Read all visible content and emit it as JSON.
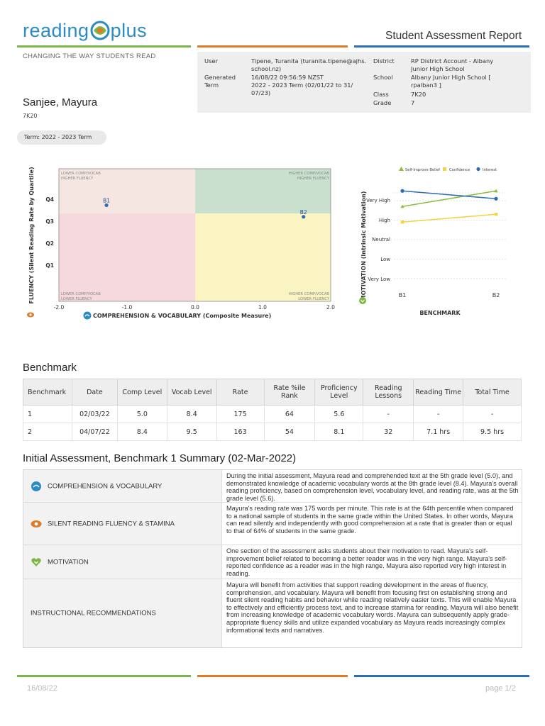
{
  "header": {
    "logo_left": "reading",
    "logo_right": "plus",
    "tagline": "CHANGING THE WAY STUDENTS READ",
    "report_title": "Student Assessment Report"
  },
  "meta": {
    "user_label": "User",
    "user_value": [
      "Tipene, Turanita (turanita.tipene@ajhs.",
      "school.nz)"
    ],
    "generated_label": "Generated",
    "generated_value": "16/08/22 09:56:59 NZST",
    "term_label": "Term",
    "term_value": [
      "2022 - 2023 Term  (02/01/22 to 31/",
      "07/23)"
    ],
    "district_label": "District",
    "district_value": [
      "RP District Account - Albany",
      "Junior High School"
    ],
    "school_label": "School",
    "school_value": [
      "Albany Junior High School [",
      "rpalban3 ]"
    ],
    "class_label": "Class",
    "class_value": "7K20",
    "grade_label": "Grade",
    "grade_value": "7"
  },
  "student": {
    "name": "Sanjee, Mayura",
    "class": "7K20",
    "term_pill": "Term: 2022 - 2023 Term"
  },
  "quadrant_chart": {
    "ylabel": "FLUENCY (Silent Reading Rate by Quartile)",
    "xlabel": "COMPREHENSION & VOCABULARY (Composite Measure)",
    "x_ticks": [
      "-2.0",
      "-1.0",
      "0.0",
      "1.0",
      "2.0"
    ],
    "y_ticks": [
      "Q4",
      "Q3",
      "Q2",
      "Q1"
    ],
    "q_tl": [
      "LOWER COMP/VOCAB",
      "HIGHER FLUENCY"
    ],
    "q_tr": [
      "HIGHER COMP/VOCAB",
      "HIGHER FLUENCY"
    ],
    "q_bl": [
      "LOWER COMP/VOCAB",
      "LOWER FLUENCY"
    ],
    "q_br": [
      "HIGHER COMP/VOCAB",
      "LOWER FLUENCY"
    ],
    "colors": {
      "tl": "#f5e6e2",
      "tr": "#c8e0cd",
      "bl": "#f6d9dc",
      "br": "#f9f4c2",
      "point": "#2e6db4"
    }
  },
  "motivation_chart": {
    "ylabel": "MOTIVATION (Intrinsic Motivation)",
    "xlabel": "BENCHMARK",
    "legend": [
      "Self-Improve Belief",
      "Confidence",
      "Interest"
    ],
    "y_ticks": [
      "Very High",
      "High",
      "Neutral",
      "Low",
      "Very Low"
    ],
    "x_ticks": [
      "B1",
      "B2"
    ],
    "colors": {
      "self_improve": "#8cbd3c",
      "confidence": "#f5d440",
      "interest": "#2e6db4"
    }
  },
  "chart_data": [
    {
      "type": "scatter",
      "xlabel": "COMPREHENSION & VOCABULARY (Composite Measure)",
      "ylabel": "FLUENCY (Silent Reading Rate by Quartile)",
      "xlim": [
        -2.0,
        2.0
      ],
      "ylim": [
        0,
        4
      ],
      "points": [
        {
          "label": "B1",
          "x": -1.3,
          "y": 2.9
        },
        {
          "label": "B2",
          "x": 1.6,
          "y": 2.55
        }
      ]
    },
    {
      "type": "line",
      "categories": [
        "B1",
        "B2"
      ],
      "ylabel": "MOTIVATION (Intrinsic Motivation)",
      "xlabel": "BENCHMARK",
      "y_scale": [
        "Very Low",
        "Low",
        "Neutral",
        "High",
        "Very High"
      ],
      "ylim": [
        1,
        5.4
      ],
      "series": [
        {
          "name": "Self-Improve Belief",
          "values": [
            4.7,
            5.5
          ]
        },
        {
          "name": "Confidence",
          "values": [
            3.9,
            4.3
          ]
        },
        {
          "name": "Interest",
          "values": [
            5.5,
            5.1
          ]
        }
      ]
    }
  ],
  "benchmark": {
    "title": "Benchmark",
    "headers": [
      "Benchmark",
      "Date",
      "Comp Level",
      "Vocab Level",
      "Rate",
      "Rate %ile Rank",
      "Proficiency Level",
      "Reading Lessons",
      "Reading Time",
      "Total Time"
    ],
    "rows": [
      [
        "1",
        "02/03/22",
        "5.0",
        "8.4",
        "175",
        "64",
        "5.6",
        "-",
        "-",
        "-"
      ],
      [
        "2",
        "04/07/22",
        "8.4",
        "9.5",
        "163",
        "54",
        "8.1",
        "32",
        "7.1 hrs",
        "9.5 hrs"
      ]
    ]
  },
  "summary": {
    "title": "Initial Assessment, Benchmark 1 Summary (02-Mar-2022)",
    "rows": [
      {
        "label": "COMPREHENSION & VOCABULARY",
        "text": "During the initial assessment, Mayura read and comprehended text at the 5th grade level (5.0), and demonstrated knowledge of academic vocabulary words at the 8th grade level (8.4). Mayura's overall reading proficiency, based on comprehension level, vocabulary level, and reading rate, was at the 5th grade level (5.6)."
      },
      {
        "label": "SILENT READING FLUENCY & STAMINA",
        "text": "Mayura's reading rate was 175 words per minute. This rate is at the 64th percentile when compared to a national sample of students in the same grade within the United States. In other words, Mayura can read silently and independently with good comprehension at a rate that is greater than or equal to that of 64% of students in the same grade."
      },
      {
        "label": "MOTIVATION",
        "text": "One section of the assessment asks students about their motivation to read. Mayura's self-improvement belief related to becoming a better reader was in the very high range. Mayura's self-reported confidence as a reader was in the high range. Mayura also reported very high interest in reading."
      },
      {
        "label": "INSTRUCTIONAL RECOMMENDATIONS",
        "text": "Mayura will benefit from activities that support reading development in the areas of fluency, comprehension, and vocabulary. Mayura will benefit from focusing first on establishing strong and fluent silent reading habits and behavior while reading relatively easier texts. This will enable Mayura to effectively and efficiently process text, and to increase stamina for reading. Mayura will also benefit from increasing knowledge of academic vocabulary words. Mayura can subsequently apply grade-appropriate fluency skills and utilize expanded vocabulary as Mayura reads increasingly complex informational texts and narratives."
      }
    ]
  },
  "footer": {
    "date": "16/08/22",
    "page": "page 1/2"
  },
  "brand_colors": {
    "green": "#7ab648",
    "orange": "#e07a26",
    "blue": "#2a6fb8"
  }
}
